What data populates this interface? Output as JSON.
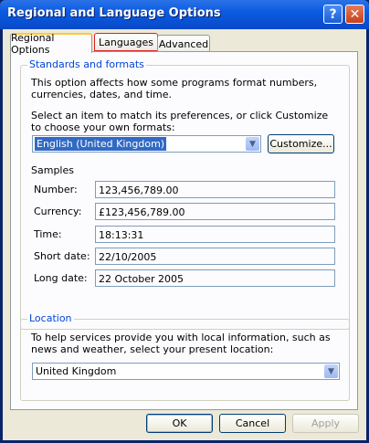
{
  "window": {
    "title": "Regional and Language Options",
    "help_label": "?",
    "close_label": "✕"
  },
  "tabs": [
    {
      "label": "Regional Options",
      "active": true
    },
    {
      "label": "Languages",
      "active": false
    },
    {
      "label": "Advanced",
      "active": false
    }
  ],
  "standards": {
    "legend": "Standards and formats",
    "description": "This option affects how some programs format numbers, currencies, dates, and time.",
    "instruction": "Select an item to match its preferences, or click Customize to choose your own formats:",
    "selected_format": "English (United Kingdom)",
    "customize_label": "Customize..."
  },
  "samples": {
    "heading": "Samples",
    "rows": [
      {
        "label": "Number:",
        "value": "123,456,789.00"
      },
      {
        "label": "Currency:",
        "value": "£123,456,789.00"
      },
      {
        "label": "Time:",
        "value": "18:13:31"
      },
      {
        "label": "Short date:",
        "value": "22/10/2005"
      },
      {
        "label": "Long date:",
        "value": "22 October 2005"
      }
    ]
  },
  "location": {
    "legend": "Location",
    "description": "To help services provide you with local information, such as news and weather, select your present location:",
    "selected": "United Kingdom"
  },
  "buttons": {
    "ok": "OK",
    "cancel": "Cancel",
    "apply": "Apply"
  },
  "colors": {
    "title_bar": "#0b5be0",
    "dialog_bg": "#ece9d8",
    "group_label": "#0046d5",
    "selection": "#316ac5",
    "focus_highlight": "#e02020"
  }
}
